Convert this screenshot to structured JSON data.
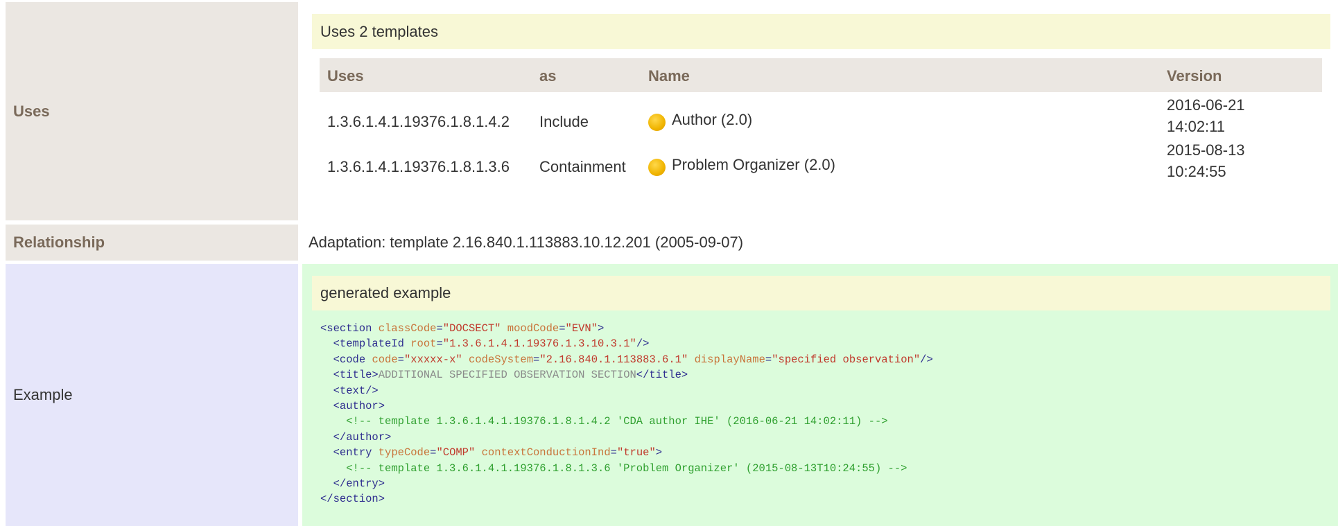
{
  "uses": {
    "label": "Uses",
    "header": "Uses 2 templates",
    "columns": [
      "Uses",
      "as",
      "Name",
      "Version"
    ],
    "rows": [
      {
        "id": "1.3.6.1.4.1.19376.1.8.1.4.2",
        "as": "Include",
        "name": "Author (2.0)",
        "version_date": "2016-06-21",
        "version_time": "14:02:11"
      },
      {
        "id": "1.3.6.1.4.1.19376.1.8.1.3.6",
        "as": "Containment",
        "name": "Problem Organizer (2.0)",
        "version_date": "2015-08-13",
        "version_time": "10:24:55"
      }
    ]
  },
  "relationship": {
    "label": "Relationship",
    "text": "Adaptation: template 2.16.840.1.113883.10.12.201 (2005-09-07)"
  },
  "example": {
    "label": "Example",
    "header": "generated example",
    "code": {
      "section_open": "<section",
      "classCode_attr": "classCode",
      "classCode_val": "\"DOCSECT\"",
      "moodCode_attr": "moodCode",
      "moodCode_val": "\"EVN\"",
      "templateId_open": "<templateId",
      "root_attr": "root",
      "root_val": "\"1.3.6.1.4.1.19376.1.3.10.3.1\"",
      "code_open": "<code",
      "code_attr": "code",
      "code_val": "\"xxxxx-x\"",
      "codeSystem_attr": "codeSystem",
      "codeSystem_val": "\"2.16.840.1.113883.6.1\"",
      "displayName_attr": "displayName",
      "displayName_val": "\"specified observation\"",
      "title_open": "<title>",
      "title_text": "ADDITIONAL SPECIFIED OBSERVATION SECTION",
      "title_close": "</title>",
      "text_tag": "<text/>",
      "author_open": "<author>",
      "author_comment": "<!-- template 1.3.6.1.4.1.19376.1.8.1.4.2 'CDA author IHE' (2016-06-21 14:02:11) -->",
      "author_close": "</author>",
      "entry_open": "<entry",
      "typeCode_attr": "typeCode",
      "typeCode_val": "\"COMP\"",
      "ccInd_attr": "contextConductionInd",
      "ccInd_val": "\"true\"",
      "entry_comment": "<!-- template 1.3.6.1.4.1.19376.1.8.1.3.6 'Problem Organizer' (2015-08-13T10:24:55) -->",
      "entry_close": "</entry>",
      "section_close": "</section>"
    }
  }
}
